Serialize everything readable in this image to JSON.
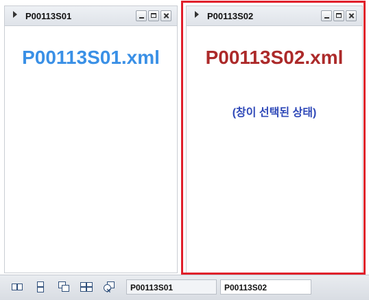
{
  "windows": [
    {
      "title": "P00113S01",
      "filename": "P00113S01.xml",
      "selected": false
    },
    {
      "title": "P00113S02",
      "filename": "P00113S02.xml",
      "selected": true,
      "note": "(창이 선택된 상태)"
    }
  ],
  "taskbar": {
    "icons": [
      "tile-vertical-icon",
      "tile-horizontal-icon",
      "cascade-icon",
      "tile-grid-icon",
      "close-all-icon"
    ],
    "tabs": [
      "P00113S01",
      "P00113S02"
    ]
  },
  "colors": {
    "file1": "#3a90e6",
    "file2": "#ac2a2a",
    "note": "#2e48b8",
    "selection_frame": "#e01e2a"
  }
}
